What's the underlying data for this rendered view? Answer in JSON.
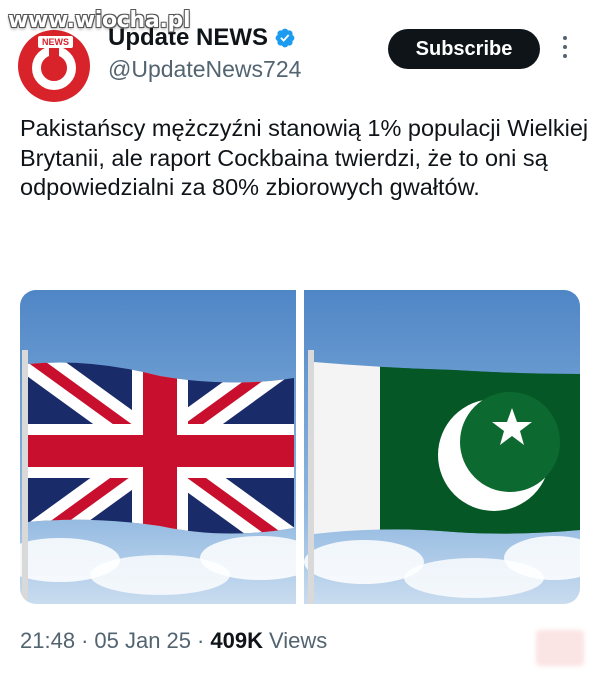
{
  "watermark": "www.wiocha.pl",
  "account": {
    "avatar_tag": "NEWS",
    "name": "Update NEWS",
    "handle": "@UpdateNews724",
    "verified": true
  },
  "actions": {
    "subscribe_label": "Subscribe"
  },
  "tweet": {
    "text": "Pakistańscy mężczyźni stanowią 1% populacji Wielkiej Brytanii, ale raport Cockbaina twierdzi, że to oni są odpowiedzialni za 80% zbiorowych gwałtów."
  },
  "media": [
    {
      "subject": "uk-flag"
    },
    {
      "subject": "pakistan-flag"
    }
  ],
  "meta": {
    "time": "21:48",
    "date": "05 Jan 25",
    "views_count": "409K",
    "views_label": "Views",
    "separator": "·"
  },
  "colors": {
    "accent_black": "#0f1419",
    "secondary_text": "#536471",
    "verified_blue": "#1d9bf0",
    "avatar_red": "#d8232a",
    "uk_blue": "#1a2b6a",
    "uk_red": "#c8102e",
    "pk_green": "#01411c"
  }
}
